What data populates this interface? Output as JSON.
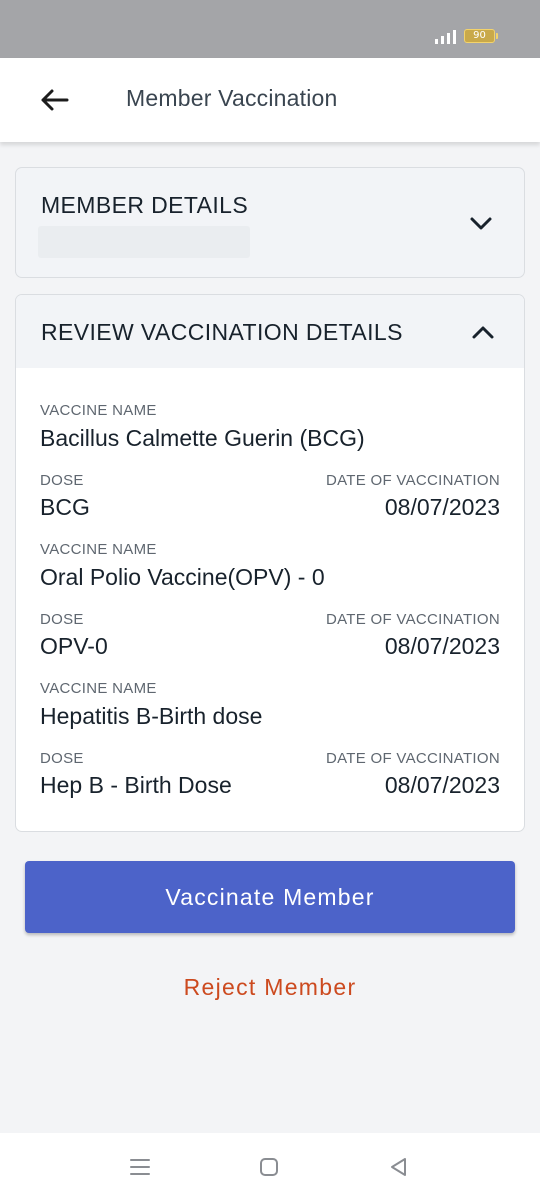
{
  "status_bar": {
    "battery": "90"
  },
  "header": {
    "title": "Member Vaccination"
  },
  "member_details": {
    "title": "MEMBER DETAILS"
  },
  "review": {
    "title": "REVIEW VACCINATION DETAILS",
    "vaccine_label": "VACCINE NAME",
    "dose_label": "DOSE",
    "date_label": "DATE OF VACCINATION",
    "items": [
      {
        "vaccine": "Bacillus Calmette Guerin (BCG)",
        "dose": "BCG",
        "date": "08/07/2023"
      },
      {
        "vaccine": "Oral Polio Vaccine(OPV) - 0",
        "dose": "OPV-0",
        "date": "08/07/2023"
      },
      {
        "vaccine": "Hepatitis B-Birth dose",
        "dose": "Hep B - Birth Dose",
        "date": "08/07/2023"
      }
    ]
  },
  "actions": {
    "vaccinate": "Vaccinate Member",
    "reject": "Reject Member"
  },
  "colors": {
    "primary": "#4c63c9",
    "reject": "#cc4a1f"
  }
}
